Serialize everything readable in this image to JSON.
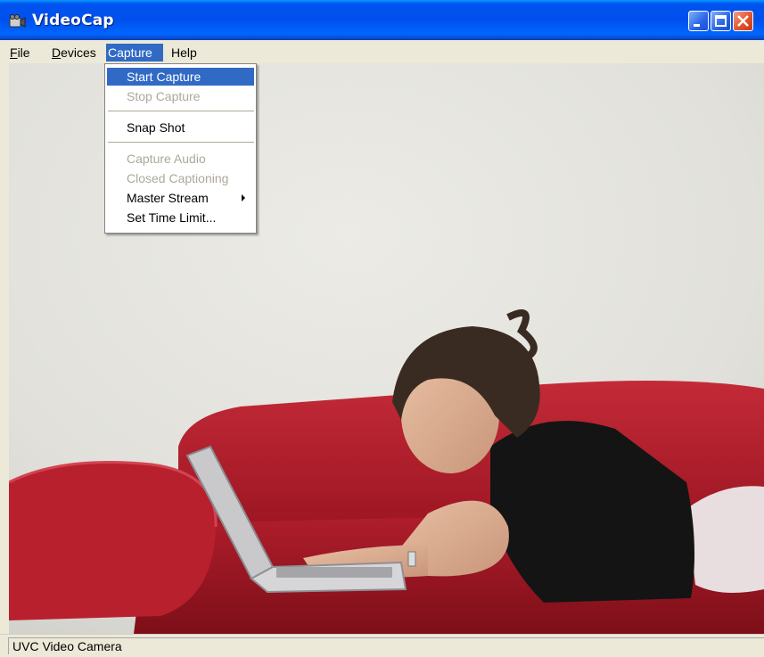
{
  "window": {
    "title": "VideoCap"
  },
  "menubar": {
    "items": [
      {
        "label": "File",
        "mnemonic": "F",
        "rest": "ile"
      },
      {
        "label": "Devices",
        "mnemonic": "D",
        "rest": "evices"
      },
      {
        "label": "Capture"
      },
      {
        "label": "Help"
      }
    ]
  },
  "capture_menu": {
    "items": [
      {
        "label": "Start Capture",
        "state": "highlighted"
      },
      {
        "label": "Stop Capture",
        "state": "disabled"
      },
      {
        "label": "Snap Shot",
        "state": "enabled"
      },
      {
        "label": "Capture Audio",
        "state": "disabled"
      },
      {
        "label": "Closed Captioning",
        "state": "disabled"
      },
      {
        "label": "Master Stream",
        "state": "enabled",
        "submenu": true
      },
      {
        "label": "Set Time Limit...",
        "state": "enabled"
      }
    ]
  },
  "statusbar": {
    "text": "UVC Video Camera"
  },
  "colors": {
    "titlebar": "#0053ee",
    "menu_highlight": "#316ac5",
    "disabled_text": "#aca899",
    "sofa": "#b21e2c"
  },
  "icons": {
    "app": "video-camera-icon",
    "minimize": "minimize-icon",
    "maximize": "maximize-icon",
    "close": "close-icon"
  }
}
